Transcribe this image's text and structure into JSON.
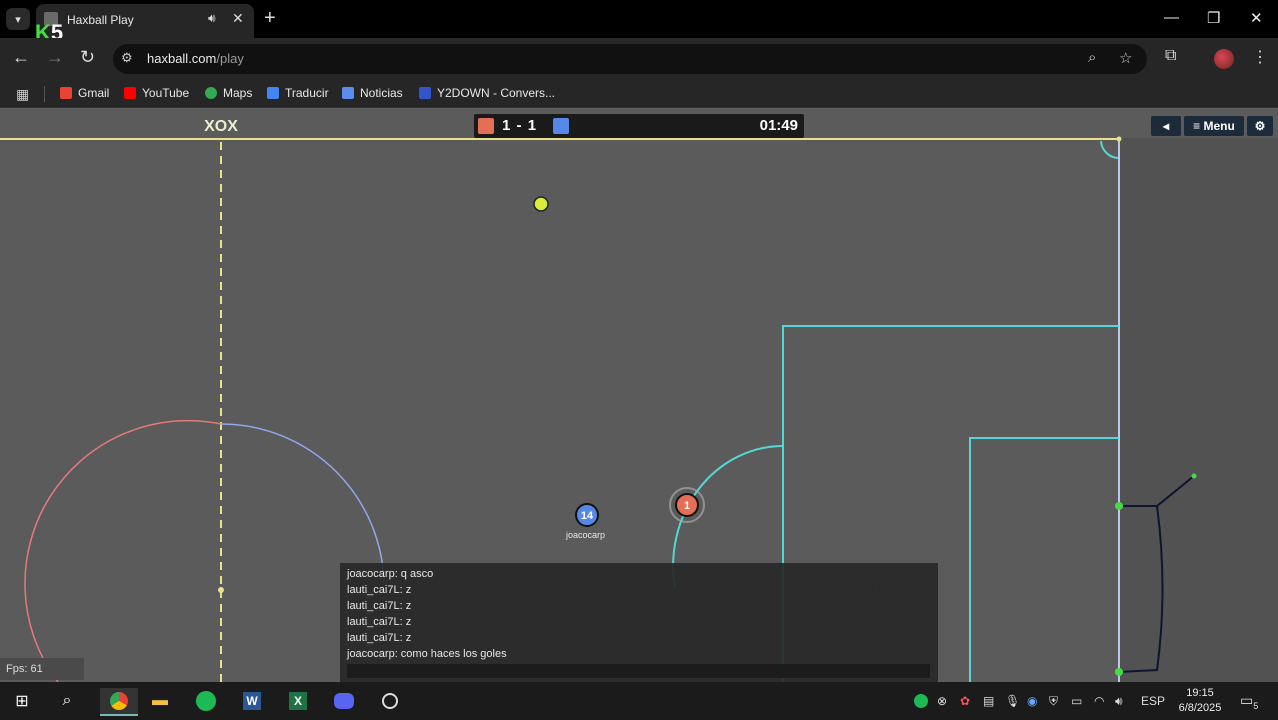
{
  "browser": {
    "tab": {
      "title": "Haxball Play"
    },
    "overlay_logo": {
      "k": "K",
      "n": "5"
    },
    "url": {
      "host": "haxball.com",
      "path": "/play"
    },
    "bookmarks": [
      {
        "label": "Gmail",
        "color": "#ea4335"
      },
      {
        "label": "YouTube",
        "color": "#ff0000"
      },
      {
        "label": "Maps",
        "color": "#34a853"
      },
      {
        "label": "Traducir",
        "color": "#4285f4"
      },
      {
        "label": "Noticias",
        "color": "#5b8def"
      },
      {
        "label": "Y2DOWN - Convers...",
        "color": "#3355cc"
      }
    ]
  },
  "game": {
    "red_score": "1",
    "separator": "-",
    "blue_score": "1",
    "timer": "01:49",
    "menu_label": "Menu",
    "team_colors": {
      "red": "#e56e56",
      "blue": "#5689e5"
    },
    "players": [
      {
        "number": "14",
        "name": "joacocarp",
        "team": "blue"
      },
      {
        "number": "1",
        "name": "",
        "team": "red"
      }
    ],
    "fps": "Fps: 61",
    "chat": [
      "joacocarp: q asco",
      "lauti_cai7L: z",
      "lauti_cai7L: z",
      "lauti_cai7L: z",
      "lauti_cai7L: z",
      "joacocarp: como haces los goles"
    ]
  },
  "taskbar": {
    "lang": "ESP",
    "time": "19:15",
    "date": "6/8/2025",
    "notifications": "5"
  }
}
